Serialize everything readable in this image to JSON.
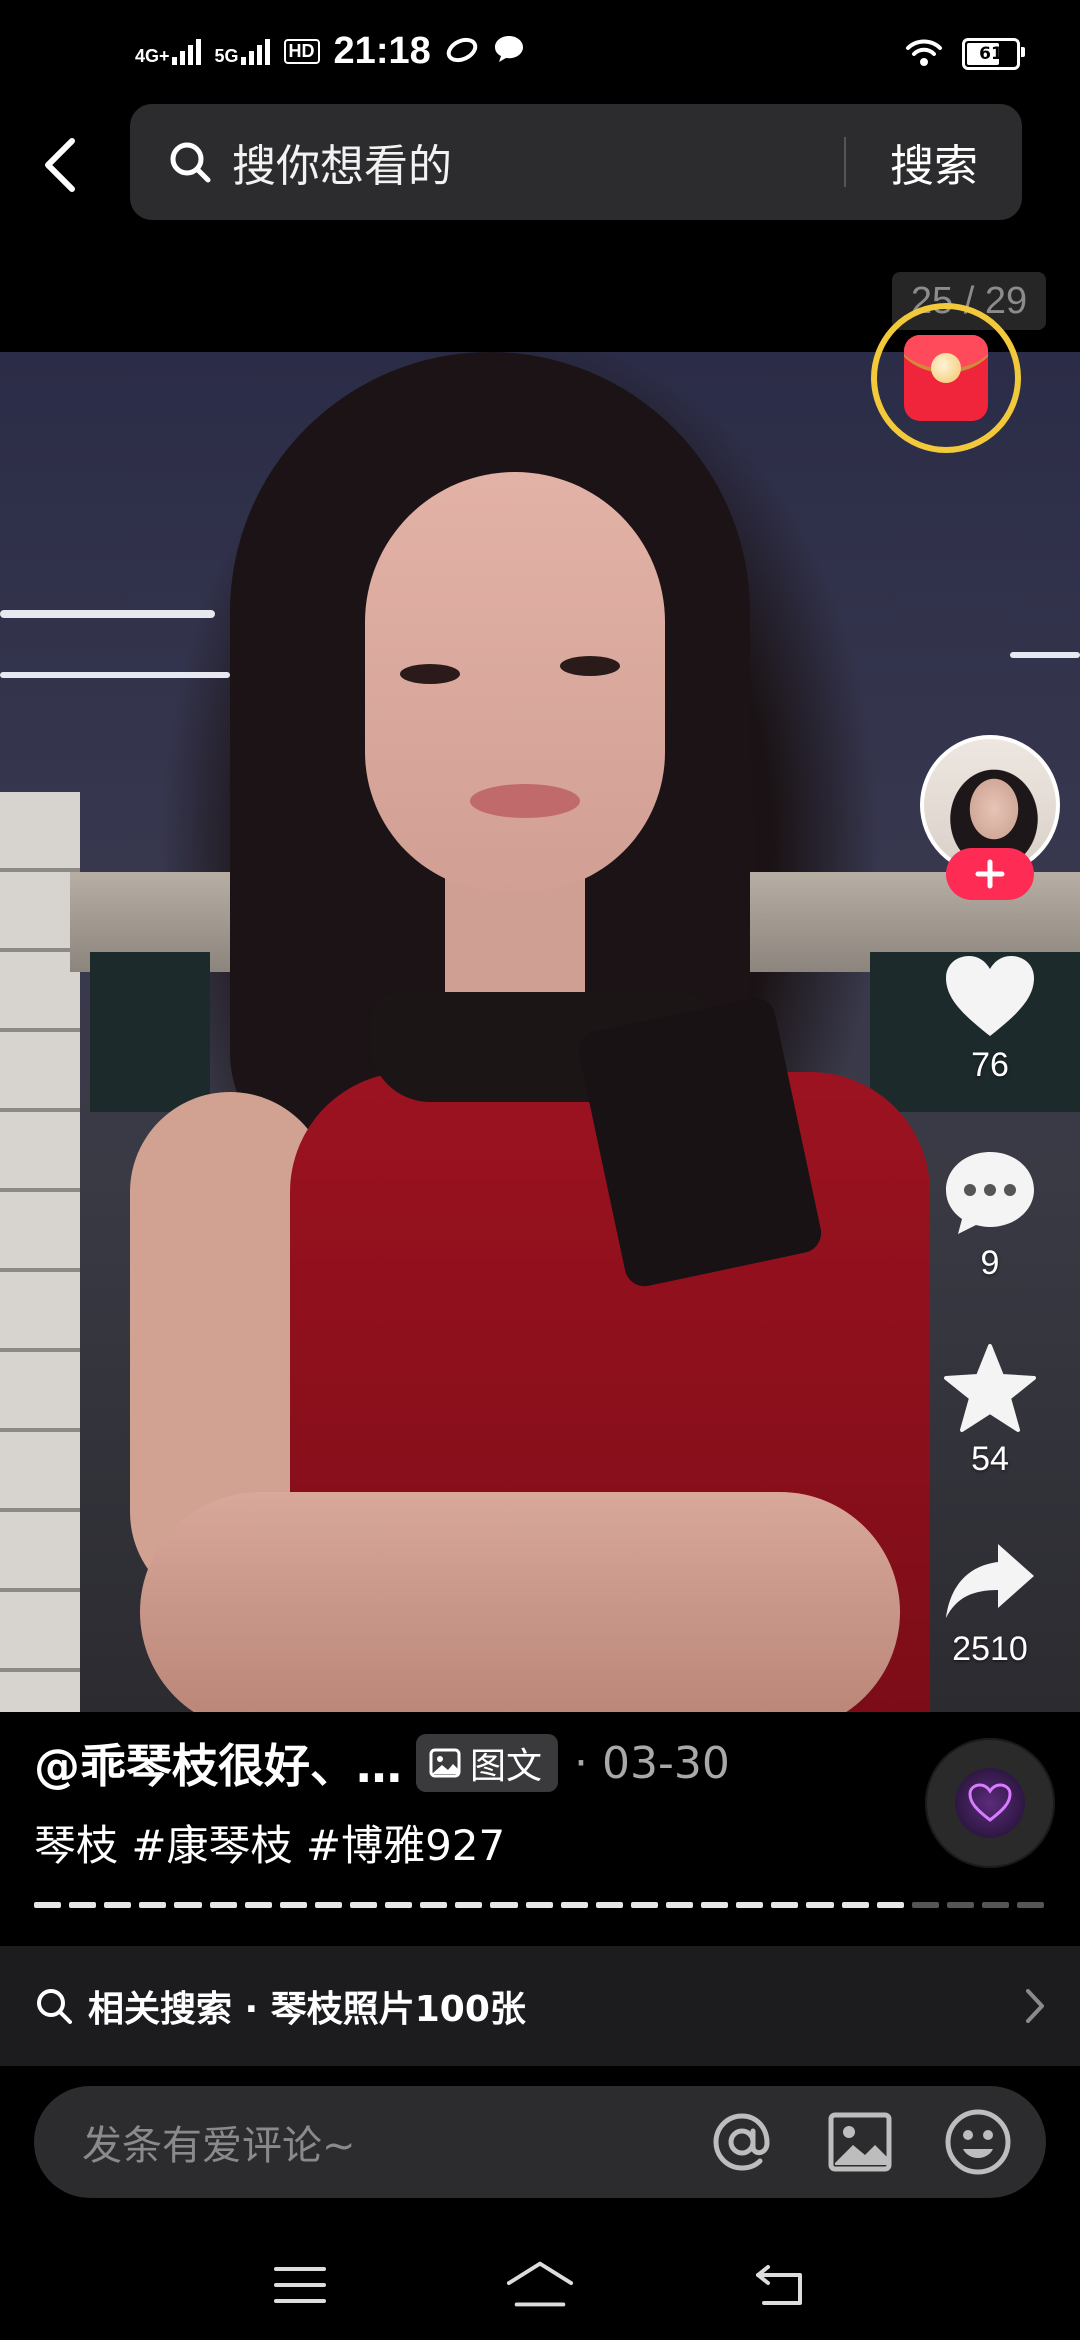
{
  "status_bar": {
    "network_1": "4G+",
    "network_2": "5G",
    "hd_label": "HD",
    "time": "21:18",
    "battery": "61"
  },
  "search": {
    "placeholder": "搜你想看的",
    "button_label": "搜索"
  },
  "image_counter": "25 / 29",
  "actions": {
    "like_count": "76",
    "comment_count": "9",
    "favorite_count": "54",
    "share_count": "2510"
  },
  "post": {
    "author": "@乖琴枝很好、…",
    "type_tag": "图文",
    "date": "· 03-30",
    "description": "琴枝 #康琴枝 #博雅927"
  },
  "related_search": {
    "text": "相关搜索 · 琴枝照片100张"
  },
  "comment": {
    "placeholder": "发条有爱评论~"
  },
  "colors": {
    "accent_pink": "#fe2c55",
    "redpacket_ring": "#f1c93a",
    "background": "#000000"
  }
}
